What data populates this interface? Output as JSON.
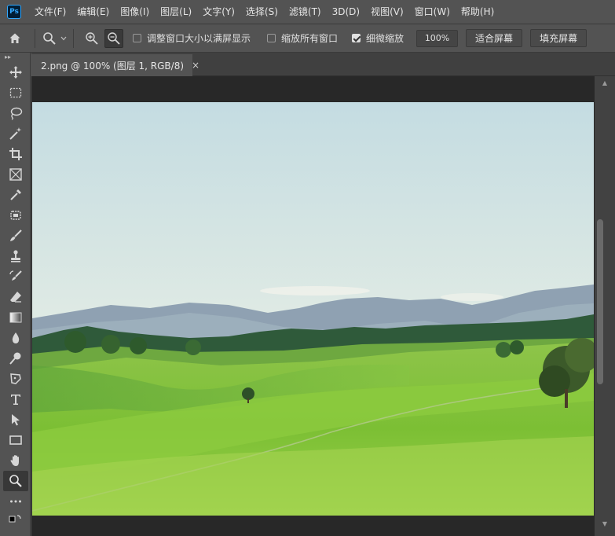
{
  "app": {
    "logo": "Ps"
  },
  "menu": [
    "文件(F)",
    "编辑(E)",
    "图像(I)",
    "图层(L)",
    "文字(Y)",
    "选择(S)",
    "滤镜(T)",
    "3D(D)",
    "视图(V)",
    "窗口(W)",
    "帮助(H)"
  ],
  "options": {
    "resize_windows_label": "调整窗口大小以满屏显示",
    "resize_windows_checked": false,
    "zoom_all_label": "缩放所有窗口",
    "zoom_all_checked": false,
    "scrubby_zoom_label": "细微缩放",
    "scrubby_zoom_checked": true,
    "zoom_value": "100%",
    "fit_screen_label": "适合屏幕",
    "fill_screen_label": "填充屏幕"
  },
  "document": {
    "tab_title": "2.png @ 100% (图层 1, RGB/8)",
    "close_glyph": "×"
  },
  "tools": [
    {
      "name": "move-tool",
      "icon": "move-icon"
    },
    {
      "name": "marquee-tool",
      "icon": "rectangular-marquee-icon"
    },
    {
      "name": "lasso-tool",
      "icon": "lasso-icon"
    },
    {
      "name": "magic-wand-tool",
      "icon": "magic-wand-icon"
    },
    {
      "name": "crop-tool",
      "icon": "crop-icon"
    },
    {
      "name": "frame-tool",
      "icon": "frame-icon"
    },
    {
      "name": "eyedropper-tool",
      "icon": "eyedropper-icon"
    },
    {
      "name": "healing-tool",
      "icon": "healing-brush-icon"
    },
    {
      "name": "brush-tool",
      "icon": "brush-icon"
    },
    {
      "name": "stamp-tool",
      "icon": "clone-stamp-icon"
    },
    {
      "name": "history-brush-tool",
      "icon": "history-brush-icon"
    },
    {
      "name": "eraser-tool",
      "icon": "eraser-icon"
    },
    {
      "name": "gradient-tool",
      "icon": "gradient-icon"
    },
    {
      "name": "blur-tool",
      "icon": "blur-drop-icon"
    },
    {
      "name": "dodge-tool",
      "icon": "dodge-icon"
    },
    {
      "name": "pen-tool",
      "icon": "pen-icon"
    },
    {
      "name": "type-tool",
      "icon": "type-icon"
    },
    {
      "name": "path-select-tool",
      "icon": "path-selection-icon"
    },
    {
      "name": "rectangle-tool",
      "icon": "rectangle-icon"
    },
    {
      "name": "hand-tool",
      "icon": "hand-icon"
    },
    {
      "name": "zoom-tool",
      "icon": "zoom-icon",
      "active": true
    },
    {
      "name": "more-tools",
      "icon": "more-icon"
    }
  ],
  "colors": {
    "panel": "#535353",
    "canvas_bg": "#282828",
    "accent": "#31a8ff"
  }
}
